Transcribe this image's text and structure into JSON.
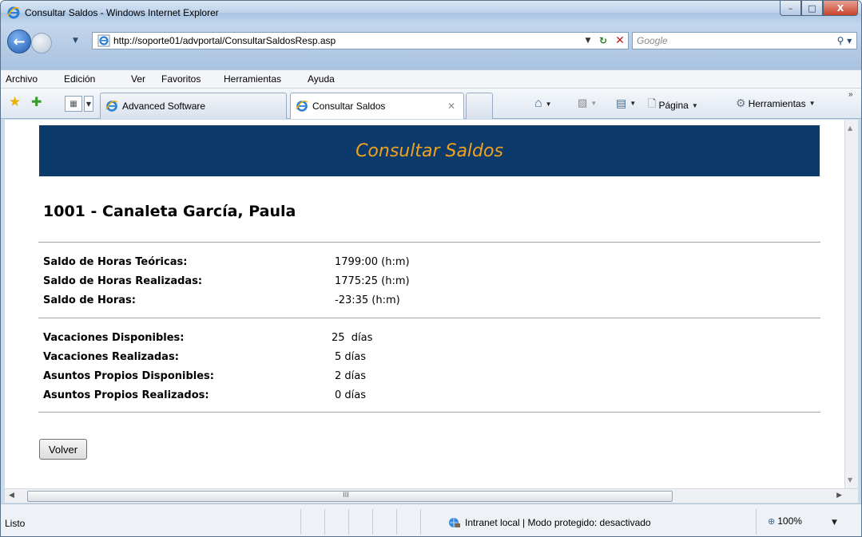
{
  "window": {
    "title": "Consultar Saldos - Windows Internet Explorer",
    "controls": {
      "minimize": "–",
      "maximize": "□",
      "close": "X"
    }
  },
  "addressbar": {
    "url": "http://soporte01/advportal/ConsultarSaldosResp.asp",
    "search_placeholder": "Google"
  },
  "menu": [
    "Archivo",
    "Edición",
    "Ver",
    "Favoritos",
    "Herramientas",
    "Ayuda"
  ],
  "tabs": [
    {
      "label": "Advanced Software",
      "active": false
    },
    {
      "label": "Consultar Saldos",
      "active": true
    }
  ],
  "commandbar": {
    "page_label": "Página",
    "tools_label": "Herramientas"
  },
  "page": {
    "banner_title": "Consultar Saldos",
    "employee": "1001 - Canaleta García, Paula",
    "hours": [
      {
        "label": "Saldo de Horas Teóricas:",
        "value": "1799:00 (h:m)"
      },
      {
        "label": "Saldo de Horas Realizadas:",
        "value": "1775:25 (h:m)"
      },
      {
        "label": "Saldo de Horas:",
        "value": "-23:35 (h:m)"
      }
    ],
    "leave": [
      {
        "label": "Vacaciones Disponibles:",
        "value": "25  días"
      },
      {
        "label": "Vacaciones Realizadas:",
        "value": "5 días"
      },
      {
        "label": "Asuntos Propios Disponibles:",
        "value": "2 días"
      },
      {
        "label": "Asuntos Propios Realizados:",
        "value": "0 días"
      }
    ],
    "back_button": "Volver"
  },
  "statusbar": {
    "status": "Listo",
    "zone": "Intranet local | Modo protegido: desactivado",
    "zoom": "100%"
  }
}
